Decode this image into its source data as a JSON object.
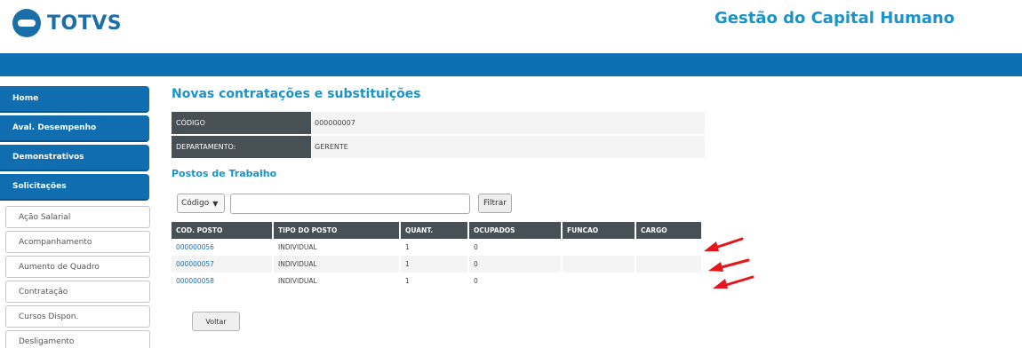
{
  "header": {
    "logo_text": "TOTVS",
    "app_title": "Gestão do Capital Humano"
  },
  "sidebar": {
    "menu": [
      {
        "label": "Home"
      },
      {
        "label": "Aval. Desempenho"
      },
      {
        "label": "Demonstrativos"
      },
      {
        "label": "Solicitações"
      }
    ],
    "sub_items": [
      {
        "label": "Ação Salarial"
      },
      {
        "label": "Acompanhamento"
      },
      {
        "label": "Aumento de Quadro"
      },
      {
        "label": "Contratação"
      },
      {
        "label": "Cursos Dispon."
      },
      {
        "label": "Desligamento"
      }
    ]
  },
  "main": {
    "title": "Novas contratações e substituições",
    "info": [
      {
        "label": "CÓDIGO",
        "value": "000000007"
      },
      {
        "label": "DEPARTAMENTO:",
        "value": "GERENTE"
      }
    ],
    "section_title": "Postos de Trabalho",
    "filter": {
      "select_value": "Código",
      "input_value": "",
      "button_label": "Filtrar"
    },
    "table": {
      "columns": [
        "COD. POSTO",
        "TIPO DO POSTO",
        "QUANT.",
        "OCUPADOS",
        "FUNCAO",
        "CARGO"
      ],
      "rows": [
        [
          "000000056",
          "INDIVIDUAL",
          "1",
          "0",
          "",
          ""
        ],
        [
          "000000057",
          "INDIVIDUAL",
          "1",
          "0",
          "",
          ""
        ],
        [
          "000000058",
          "INDIVIDUAL",
          "1",
          "0",
          "",
          ""
        ]
      ]
    },
    "back_label": "Voltar"
  },
  "colors": {
    "brand_blue": "#0c6eb3",
    "title_blue": "#1a93c7",
    "header_gray": "#475055",
    "annotation_red": "#e8141b"
  }
}
